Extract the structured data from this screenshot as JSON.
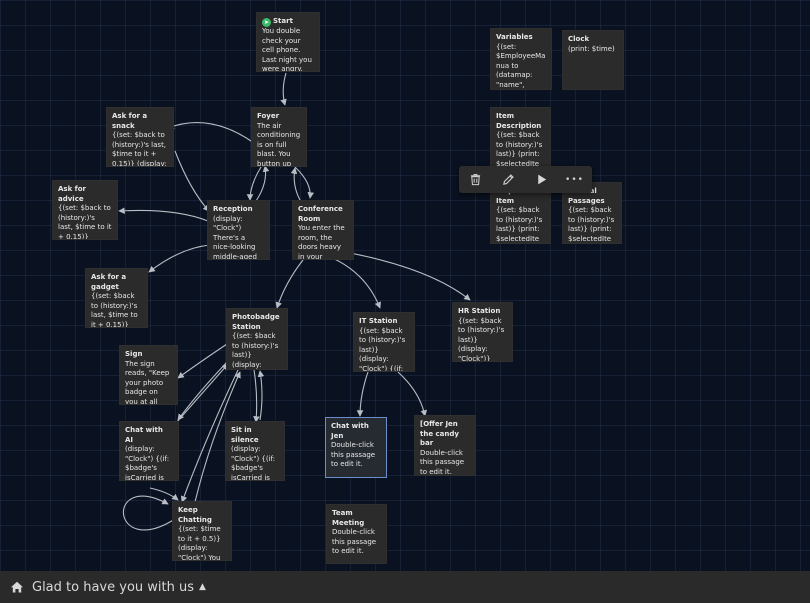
{
  "passages": {
    "start": {
      "title": "Start",
      "excerpt": "You double check your cell phone. Last night you were angry. Today"
    },
    "foyer": {
      "title": "Foyer",
      "excerpt": "The air conditioning is on full blast. You button up and stick your"
    },
    "ask_snack": {
      "title": "Ask for a snack",
      "excerpt": "{(set: $back to (history:)'s last, $time to it + 0.15)} (display: \"Clock\") \"I'd"
    },
    "ask_advice": {
      "title": "Ask for advice",
      "excerpt": "{(set: $back to (history:)'s last, $time to it + 0.15)} (display: \"Clock\") {(if:"
    },
    "reception": {
      "title": "Reception",
      "excerpt": "(display: \"Clock\") There's a nice-looking middle-aged woman"
    },
    "conference": {
      "title": "Conference Room",
      "excerpt": "You enter the room, the doors heavy in your hands. You see"
    },
    "ask_gadget": {
      "title": "Ask for a gadget",
      "excerpt": "{(set: $back to (history:)'s last, $time to it + 0.15)} (display:"
    },
    "photobadge": {
      "title": "Photobadge Station",
      "excerpt": "{(set: $back to (history:)'s last)} (display: \"Clock\") {(if:"
    },
    "it_station": {
      "title": "IT Station",
      "excerpt": "{(set: $back to (history:)'s last)} (display: \"Clock\") {(if: $ItPeopleNumber"
    },
    "hr_station": {
      "title": "HR Station",
      "excerpt": "{(set: $back to (history:)'s last)} (display: \"Clock\")}"
    },
    "sign": {
      "title": "Sign",
      "excerpt": "The sign reads, \"Keep your photo badge on you at all times. Your photo will"
    },
    "chat_ai": {
      "title": "Chat with AI",
      "excerpt": "(display: \"Clock\") {(if: $badge's isCarried is false)[ {(set:"
    },
    "sit_silence": {
      "title": "Sit in silence",
      "excerpt": "(display: \"Clock\") {(if: $badge's isCarried is false)[ {(set:"
    },
    "chat_jen": {
      "title": "Chat with Jen",
      "excerpt": "Double-click this passage to edit it."
    },
    "offer_jen": {
      "title": "[Offer Jen the candy bar",
      "excerpt": "Double-click this passage to edit it."
    },
    "keep_chatting": {
      "title": "Keep Chatting",
      "excerpt": "{(set: $time to it + 0.5)} (display: \"Clock\") You continue to engage AI on"
    },
    "team_meeting": {
      "title": "Team Meeting",
      "excerpt": "Double-click this passage to edit it."
    },
    "variables": {
      "title": "Variables",
      "excerpt": "{(set: $EmployeeManua to (datamap: \"name\", \"employee"
    },
    "clock": {
      "title": "Clock",
      "excerpt": "(print: $time)"
    },
    "item_description": {
      "title": "Item Description",
      "excerpt": "{(set: $back to (history:)'s last)} (print: $selectedItem's"
    },
    "acquire_item": {
      "title": "Acquire Item",
      "excerpt": "{(set: $back to (history:)'s last)} (print: $selectedItem's pickupText)"
    },
    "manual_passages": {
      "title": "Manual Passages",
      "excerpt": "{(set: $back to (history:)'s last)} (print: $selectedItem's"
    }
  },
  "toolbar": {
    "delete_icon": "trash-icon",
    "edit_icon": "pencil-icon",
    "test_icon": "play-icon",
    "more_icon": "ellipsis-icon",
    "more_label": "•••"
  },
  "footer": {
    "home_icon": "home-icon",
    "label": "Glad to have you with us",
    "caret": "▲"
  },
  "colors": {
    "background": "#0a1120",
    "passage": "#2b2b2b",
    "selected_border": "#6a8ec8",
    "link": "#b8bcc4",
    "start_icon": "#3bb86b",
    "footer": "#2a2a2a"
  }
}
